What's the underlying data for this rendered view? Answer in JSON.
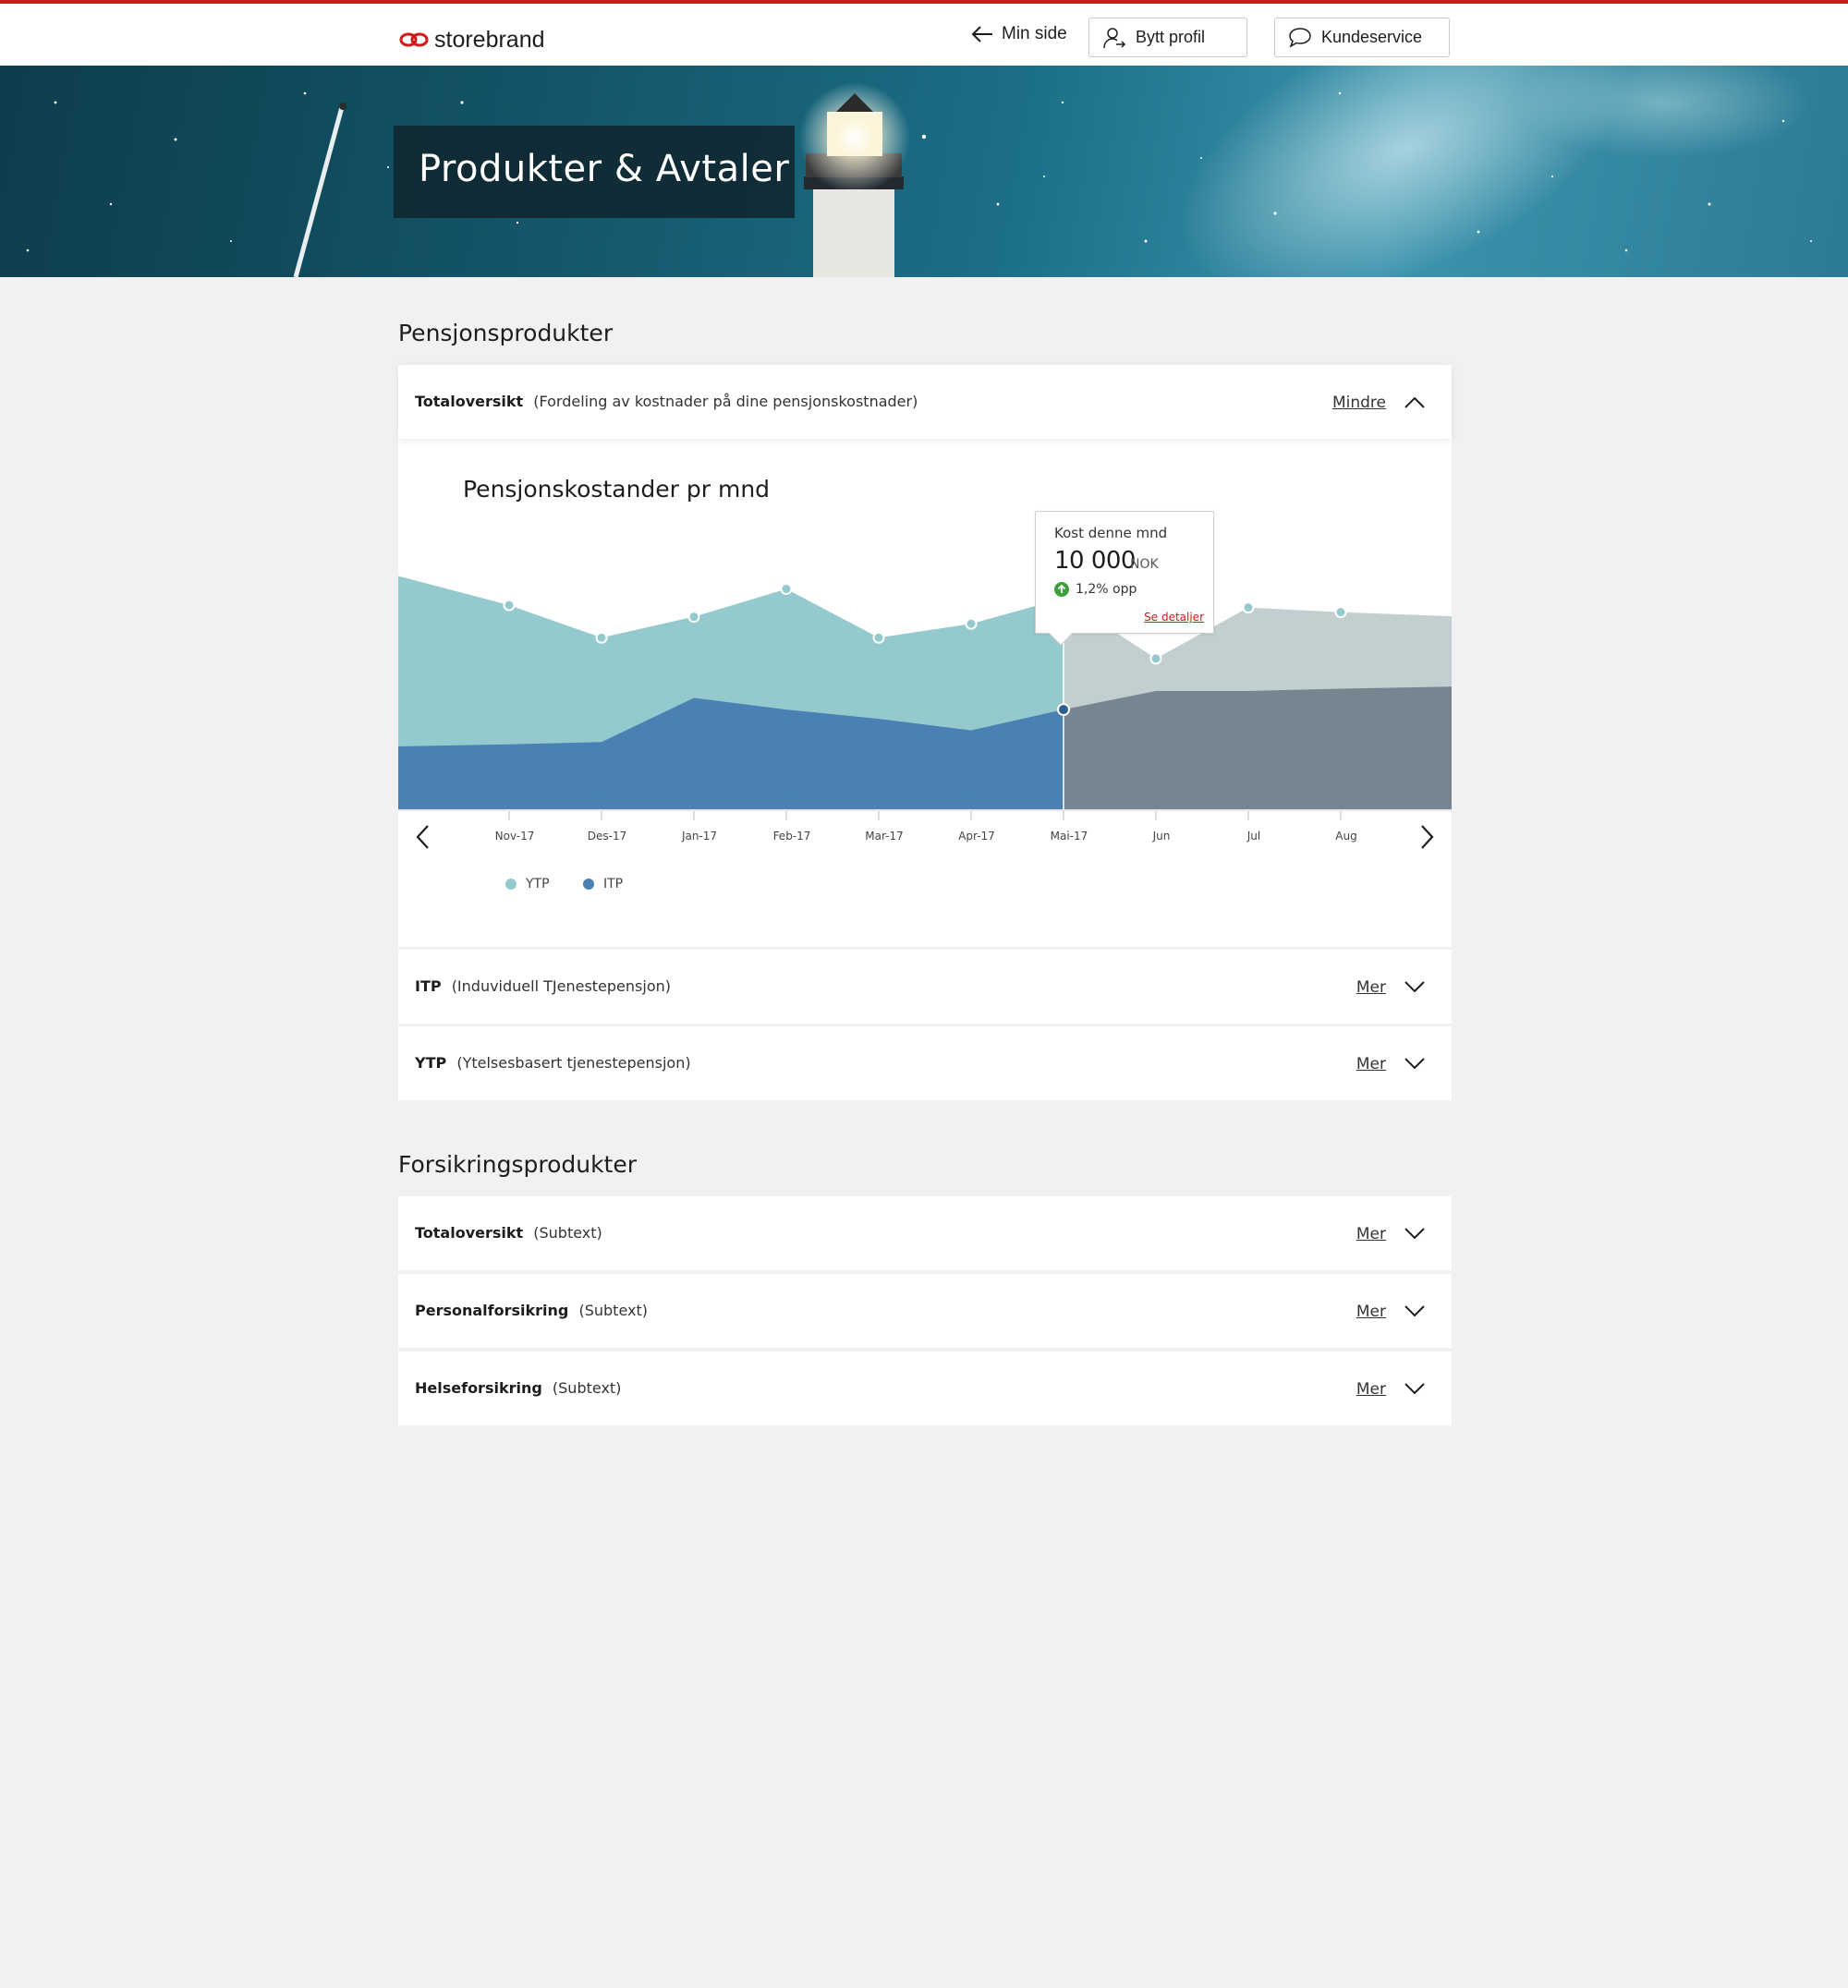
{
  "header": {
    "brand": "storebrand",
    "back_label": "Min side",
    "profile_label": "Bytt profil",
    "service_label": "Kundeservice"
  },
  "hero": {
    "title": "Produkter & Avtaler"
  },
  "pension": {
    "title": "Pensjonsprodukter",
    "overview": {
      "label": "Totaloversikt",
      "subtext": "(Fordeling av kostnader på dine pensjonskostnader)",
      "toggle": "Mindre"
    },
    "rows": [
      {
        "label": "ITP",
        "subtext": "(Induviduell TJenestepensjon)",
        "toggle": "Mer"
      },
      {
        "label": "YTP",
        "subtext": "(Ytelsesbasert tjenestepensjon)",
        "toggle": "Mer"
      }
    ]
  },
  "insurance": {
    "title": "Forsikringsprodukter",
    "rows": [
      {
        "label": "Totaloversikt",
        "subtext": "(Subtext)",
        "toggle": "Mer"
      },
      {
        "label": "Personalforsikring",
        "subtext": "(Subtext)",
        "toggle": "Mer"
      },
      {
        "label": "Helseforsikring",
        "subtext": "(Subtext)",
        "toggle": "Mer"
      }
    ]
  },
  "tooltip": {
    "label": "Kost denne mnd",
    "value": "10 000",
    "unit": "NOK",
    "change": "1,2% opp",
    "link": "Se detaljer"
  },
  "colors": {
    "brand_red": "#d0191b",
    "ytp": "#94c9cd",
    "itp": "#4a80b4",
    "future_ytp": "#c2cfd0",
    "future_itp": "#778591"
  },
  "chart_data": {
    "type": "area",
    "title": "Pensjonskostander pr mnd",
    "categories": [
      "Nov-17",
      "Des-17",
      "Jan-17",
      "Feb-17",
      "Mar-17",
      "Apr-17",
      "Mai-17",
      "Jun",
      "Jul",
      "Aug"
    ],
    "current_index": 6,
    "series": [
      {
        "name": "YTP",
        "values": [
          88,
          74,
          83,
          95,
          74,
          80,
          91,
          65,
          87,
          85
        ],
        "color": "#94c9cd"
      },
      {
        "name": "ITP",
        "values": [
          28,
          29,
          48,
          43,
          39,
          34,
          43,
          51,
          51,
          52
        ],
        "color": "#4a80b4"
      }
    ],
    "ylim": [
      0,
      100
    ],
    "legend": "bottom-left"
  }
}
